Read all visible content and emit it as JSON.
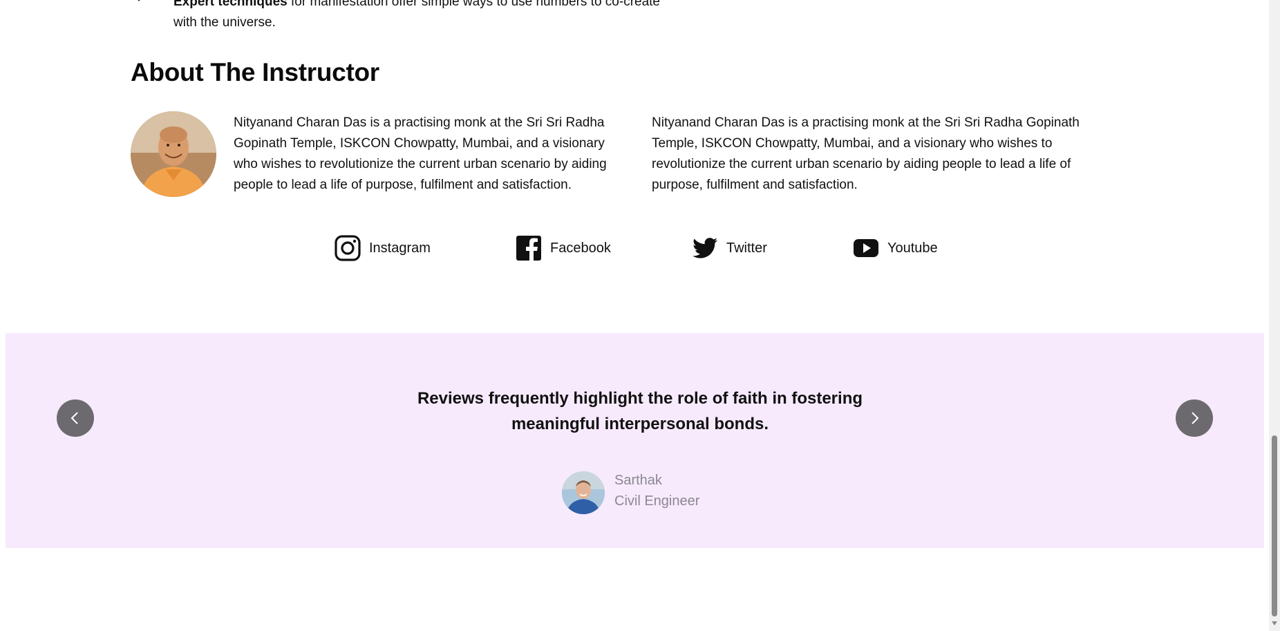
{
  "features": {
    "last_item_bold": "Expert techniques",
    "last_item_text": " for manifestation offer simple ways to use numbers to co-create with the universe."
  },
  "about": {
    "title": "About The Instructor",
    "bio_left": "Nityanand Charan Das is a practising monk at the Sri Sri Radha Gopinath Temple, ISKCON Chowpatty, Mumbai, and a visionary who wishes to revolutionize the current urban scenario by aiding people to lead a life of purpose, fulfilment and satisfaction.",
    "bio_right": "Nityanand Charan Das is a practising monk at the Sri Sri Radha Gopinath Temple, ISKCON Chowpatty, Mumbai, and a visionary who wishes to revolutionize the current urban scenario by aiding people to lead a life of purpose, fulfilment and satisfaction."
  },
  "social_links": [
    {
      "label": "Instagram",
      "icon": "instagram-icon"
    },
    {
      "label": "Facebook",
      "icon": "facebook-icon"
    },
    {
      "label": "Twitter",
      "icon": "twitter-icon"
    },
    {
      "label": "Youtube",
      "icon": "youtube-icon"
    }
  ],
  "review": {
    "quote": "Reviews frequently highlight the role of faith in fostering meaningful interpersonal bonds.",
    "name": "Sarthak",
    "role": "Civil Engineer",
    "background_color": "#f7eafd"
  },
  "colors": {
    "nav_button": "#6d6a6f",
    "reviewer_text": "#8b8890"
  }
}
